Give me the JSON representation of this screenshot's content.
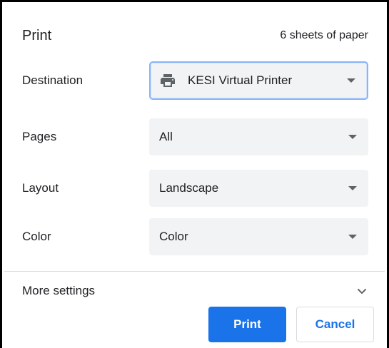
{
  "header": {
    "title": "Print",
    "sheets": "6 sheets of paper"
  },
  "settings": {
    "destination": {
      "label": "Destination",
      "value": "KESI Virtual Printer",
      "icon": "printer-icon"
    },
    "pages": {
      "label": "Pages",
      "value": "All"
    },
    "layout": {
      "label": "Layout",
      "value": "Landscape"
    },
    "color": {
      "label": "Color",
      "value": "Color"
    }
  },
  "more_settings": {
    "label": "More settings",
    "icon": "chevron-down-icon"
  },
  "buttons": {
    "print": "Print",
    "cancel": "Cancel"
  },
  "colors": {
    "accent": "#1a73e8",
    "field_bg": "#f1f3f4",
    "focus_border": "#8ab4f8",
    "text": "#202124"
  }
}
